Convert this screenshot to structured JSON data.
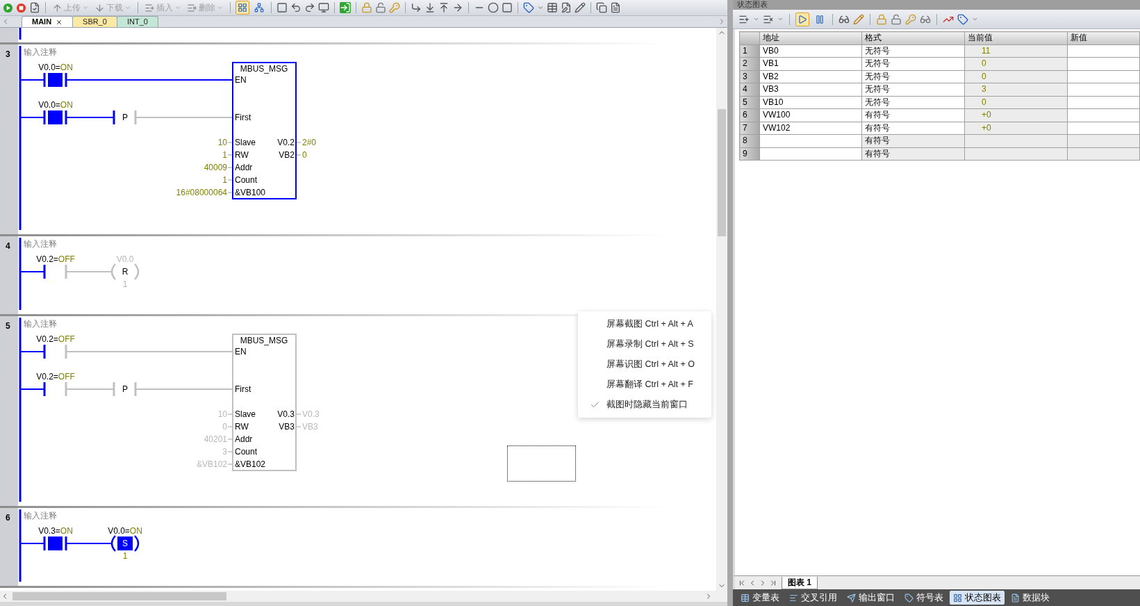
{
  "toolbar": {
    "buttons": [
      {
        "label": "上传",
        "disabled": true
      },
      {
        "label": "下载",
        "disabled": true
      },
      {
        "label": "插入",
        "disabled": true
      },
      {
        "label": "删除",
        "disabled": true
      }
    ],
    "toggles": [
      {
        "on": true
      },
      {
        "on": false
      }
    ]
  },
  "tabs": [
    {
      "label": "MAIN",
      "selected": true,
      "closable": true,
      "color": "#ffffff"
    },
    {
      "label": "SBR_0",
      "selected": false,
      "closable": false,
      "color": "#fbe9a4"
    },
    {
      "label": "INT_0",
      "selected": false,
      "closable": false,
      "color": "#c4e6d6"
    }
  ],
  "networks": [
    {
      "number": "3",
      "comment": "输入注释",
      "rows": [
        {
          "contact": {
            "address": "V0.0=",
            "status": "ON",
            "energized": true
          }
        },
        {
          "contact": {
            "address": "V0.0=",
            "status": "ON",
            "energized": true
          },
          "transition": {
            "label": "P",
            "energized": false
          }
        }
      ],
      "box": {
        "title": "MBUS_MSG",
        "energized": true,
        "inputs": [
          {
            "pin": "EN"
          },
          {
            "pin": "First"
          },
          {
            "pin": "Slave",
            "value": "10"
          },
          {
            "pin": "RW",
            "value": "1"
          },
          {
            "pin": "Addr",
            "value": "40009"
          },
          {
            "pin": "Count",
            "value": "1"
          },
          {
            "pin": "&VB100",
            "value": "16#08000064"
          }
        ],
        "outputs": [
          {
            "pin": "V0.2",
            "value": "2#0"
          },
          {
            "pin": "VB2",
            "value": "0"
          }
        ]
      }
    },
    {
      "number": "4",
      "comment": "输入注释",
      "rows": [
        {
          "contact": {
            "address": "V0.2=",
            "status": "OFF",
            "energized": false
          }
        }
      ],
      "coil": {
        "address": "V0.0",
        "letter": "R",
        "count": "1",
        "energized": false
      }
    },
    {
      "number": "5",
      "comment": "输入注释",
      "rows": [
        {
          "contact": {
            "address": "V0.2=",
            "status": "OFF",
            "energized": false
          }
        },
        {
          "contact": {
            "address": "V0.2=",
            "status": "OFF",
            "energized": false
          },
          "transition": {
            "label": "P",
            "energized": false
          }
        }
      ],
      "box": {
        "title": "MBUS_MSG",
        "energized": false,
        "inputs": [
          {
            "pin": "EN"
          },
          {
            "pin": "First"
          },
          {
            "pin": "Slave",
            "value": "10"
          },
          {
            "pin": "RW",
            "value": "0"
          },
          {
            "pin": "Addr",
            "value": "40201"
          },
          {
            "pin": "Count",
            "value": "3"
          },
          {
            "pin": "&VB102",
            "value": "&VB102"
          }
        ],
        "outputs": [
          {
            "pin": "V0.3",
            "value": "V0.3"
          },
          {
            "pin": "VB3",
            "value": "VB3"
          }
        ]
      }
    },
    {
      "number": "6",
      "comment": "输入注释",
      "rows": [
        {
          "contact": {
            "address": "V0.3=",
            "status": "ON",
            "energized": true
          }
        }
      ],
      "coil": {
        "address": "V0.0=",
        "status": "ON",
        "letter": "S",
        "count": "1",
        "energized": true
      }
    }
  ],
  "context_menu": {
    "items": [
      {
        "label": "屏幕截图",
        "shortcut": "Ctrl + Alt + A",
        "checked": false
      },
      {
        "label": "屏幕录制",
        "shortcut": "Ctrl + Alt + S",
        "checked": false
      },
      {
        "label": "屏幕识图",
        "shortcut": "Ctrl + Alt + O",
        "checked": false
      },
      {
        "label": "屏幕翻译",
        "shortcut": "Ctrl + Alt + F",
        "checked": false
      },
      {
        "label": "截图时隐藏当前窗口",
        "checked": true
      }
    ]
  },
  "status_chart": {
    "title": "状态图表",
    "toggles": [
      {
        "on": true
      },
      {
        "on": false
      }
    ],
    "columns": [
      "地址",
      "格式",
      "当前值",
      "新值"
    ],
    "rows": [
      {
        "number": "1",
        "address": "VB0",
        "format": "无符号",
        "current": "11"
      },
      {
        "number": "2",
        "address": "VB1",
        "format": "无符号",
        "current": "0"
      },
      {
        "number": "3",
        "address": "VB2",
        "format": "无符号",
        "current": "0"
      },
      {
        "number": "4",
        "address": "VB3",
        "format": "无符号",
        "current": "3"
      },
      {
        "number": "5",
        "address": "VB10",
        "format": "无符号",
        "current": "0"
      },
      {
        "number": "6",
        "address": "VW100",
        "format": "有符号",
        "current": "+0"
      },
      {
        "number": "7",
        "address": "VW102",
        "format": "有符号",
        "current": "+0"
      },
      {
        "number": "8",
        "format": "有符号"
      },
      {
        "number": "9",
        "format": "有符号"
      }
    ],
    "sheet_tabs": [
      {
        "label": "图表 1",
        "selected": true
      }
    ]
  },
  "bottom_tabs": [
    {
      "label": "变量表",
      "selected": false
    },
    {
      "label": "交叉引用",
      "selected": false
    },
    {
      "label": "输出窗口",
      "selected": false
    },
    {
      "label": "符号表",
      "selected": false
    },
    {
      "label": "状态图表",
      "selected": true
    },
    {
      "label": "数据块",
      "selected": false
    }
  ]
}
